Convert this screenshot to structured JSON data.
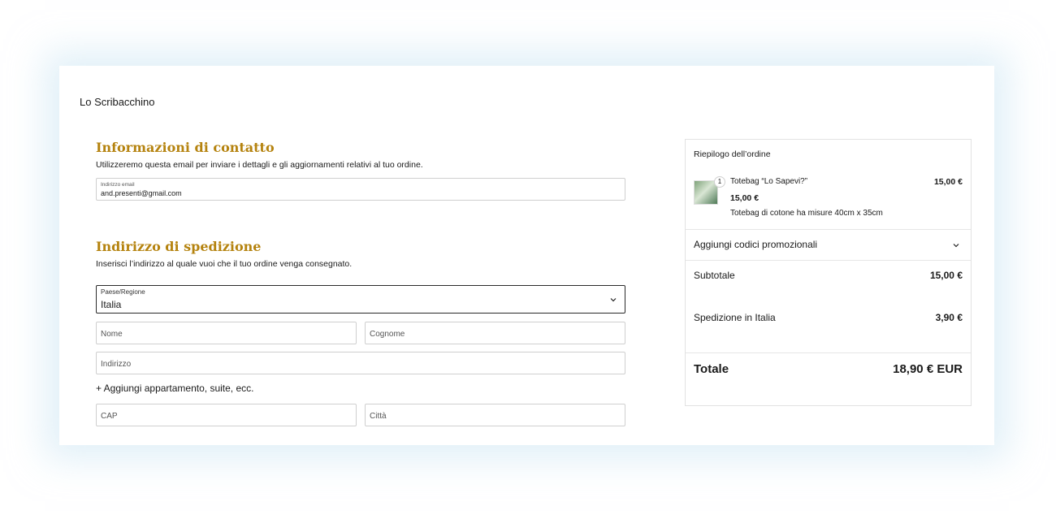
{
  "store": {
    "name": "Lo Scribacchino"
  },
  "contact": {
    "heading": "Informazioni di contatto",
    "description": "Utilizzeremo questa email per inviare i dettagli e gli aggiornamenti relativi al tuo ordine.",
    "email_label": "Indirizzo email",
    "email_value": "and.presenti@gmail.com"
  },
  "shipping": {
    "heading": "Indirizzo di spedizione",
    "description": "Inserisci l’indirizzo al quale vuoi che il tuo ordine venga consegnato.",
    "country_label": "Paese/Regione",
    "country_value": "Italia",
    "first_name_placeholder": "Nome",
    "last_name_placeholder": "Cognome",
    "address_placeholder": "Indirizzo",
    "add_apartment": "+ Aggiungi appartamento, suite, ecc.",
    "zip_placeholder": "CAP",
    "city_placeholder": "Città"
  },
  "summary": {
    "title": "Riepilogo dell’ordine",
    "item": {
      "quantity": "1",
      "name": "Totebag “Lo Sapevi?”",
      "unit_price": "15,00 €",
      "description": "Totebag di cotone ha misure 40cm x 35cm",
      "line_total": "15,00 €"
    },
    "promo_label": "Aggiungi codici promozionali",
    "subtotal_label": "Subtotale",
    "subtotal_value": "15,00 €",
    "shipping_label": "Spedizione in Italia",
    "shipping_value": "3,90 €",
    "total_label": "Totale",
    "total_value": "18,90 € EUR"
  },
  "colors": {
    "accent": "#b5830f",
    "border": "#cfcfcf",
    "glow": "#c8e4f2"
  },
  "icons": {
    "select_chevron": "chevron-down-icon",
    "promo_chevron": "chevron-down-icon",
    "product_thumb": "product-thumbnail"
  }
}
